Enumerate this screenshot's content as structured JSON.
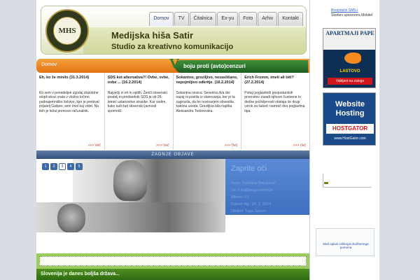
{
  "header": {
    "logo_text": "MHS",
    "title": "Medijska hiša Satir",
    "subtitle": "Studio za kreativno komunikacijo"
  },
  "nav": {
    "tabs": [
      "Domov",
      "TV",
      "Čitalnica",
      "Ex-yu",
      "Foto",
      "Arhiv",
      "Kontakt"
    ],
    "active": "Domov"
  },
  "banner": {
    "home": "Domov",
    "v_letter": "V",
    "slogan": "boju proti (avto)cenzuri"
  },
  "articles": [
    {
      "title": "Eh, ko že minilo (31.3.2014)",
      "body": "Ko sem v ponedeljek zgodaj dopoldne stopil skozi vrata v vložno krčmo podnajemniško šolstvo, kjer je prebival prijatelj Gašper, sem imel kaj videt. Na tleh je ležal prenosni računalnik.",
      "more": ">>> Več"
    },
    {
      "title": "SDS kot alternativa?! Ovbe, ovbe, ovbe ... (16.2.2014)",
      "body": "Največji in eh in spitih. Ženči slovenski piratelj in predsednik SDS je ob 25-letnici ustanovitve stranke. Kar sodim, kako tudi šuti slovenski javnosti spomočil.",
      "more": ">>> Več"
    },
    {
      "title": "Sokantno, groziljivo, nezaslišano, nepojmljivo odkritje. (16.2.2014)",
      "body": "Sokantna novica: Severina dva dni nazaj ni pustila iz stanovanja, ker je ta zagrozila, da bo novinarjem obvestila kakšna usoda. Greziljiva bila najdba Aleksandra Todorovska.",
      "more": ">>> Več"
    },
    {
      "title": "Erich Fromm, imeti ali biti? (27.2.2014)",
      "body": "Poleg poglavitnih gospodarskih prvenstev zaradi njihove čustvene in dedne poživljenosti obstaja še drugi vzrok za šalost; namreč dva poglavitna tipa.",
      "more": ">>> Več"
    }
  ],
  "latest": {
    "heading": "ZADNJE OBJAVE",
    "pages": [
      "1",
      "2",
      "3",
      "4",
      "5"
    ],
    "active_page": "3",
    "feature_title": "Zaprite oči",
    "feature_meta": [
      "Avtor: Svetlana Makarovič",
      "Vir: s knjižnega področja",
      "Album: XX",
      "Datum obj.: 26. 2. 2014",
      "Oblikel: Tuga Zaleno"
    ]
  },
  "footer": {
    "headline": "Slovenija je danes boljša država..."
  },
  "sidebar": {
    "link": "Brezplačni SMS-i",
    "sub": "Storitev sponzorira Mobitel",
    "ad1": {
      "title": "APARTMAJI PAPE",
      "label": "LASTOVO",
      "cta": "Vabljeni na zalogo"
    },
    "ad2": {
      "title": "Website Hosting",
      "brand": "HOSTGATOR",
      "url": "www.HostGator.com"
    },
    "ad3": "Mali oglasi velikega družbenega pomena"
  },
  "colors": {
    "banner_orange": "#e47312",
    "banner_green": "#2e7d32",
    "nav_active": "#243b8a",
    "latest_bar": "#34507a",
    "feature_blue": "#3e6fc0",
    "footer_green": "#2f6b12"
  }
}
